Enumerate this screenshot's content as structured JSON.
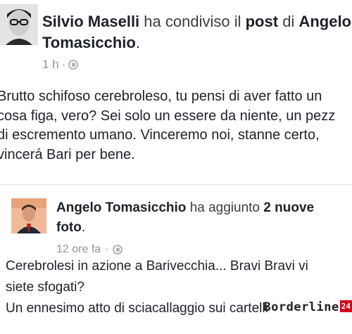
{
  "post1": {
    "author": "Silvio Maselli",
    "action": "ha condiviso il",
    "object": "post",
    "connector": "di",
    "target_first": "Angelo",
    "target_last": "Tomasicchio",
    "period": ".",
    "time": "1 h",
    "dot": "·",
    "body_lines": [
      "Brutto schifoso cerebroleso, tu pensi di aver fatto un",
      "cosa figa, vero? Sei solo un essere da niente, un pezz",
      "di escremento umano. Vinceremo noi, stanne certo,",
      "vincerá Bari per bene."
    ]
  },
  "post2": {
    "author": "Angelo Tomasicchio",
    "action": "ha aggiunto",
    "count": "2 nuove",
    "object": "foto",
    "period": ".",
    "time": "12 ore fa",
    "dot": "·",
    "body_lines": [
      "Cerebrolesi in azione a Barivecchia... Bravi Bravi vi",
      "siete sfogati?",
      "Un ennesimo atto di sciacallaggio sui cartelli"
    ]
  },
  "watermark": {
    "text": "Borderline",
    "tag": "24"
  },
  "icons": {
    "privacy": "globe-icon"
  }
}
